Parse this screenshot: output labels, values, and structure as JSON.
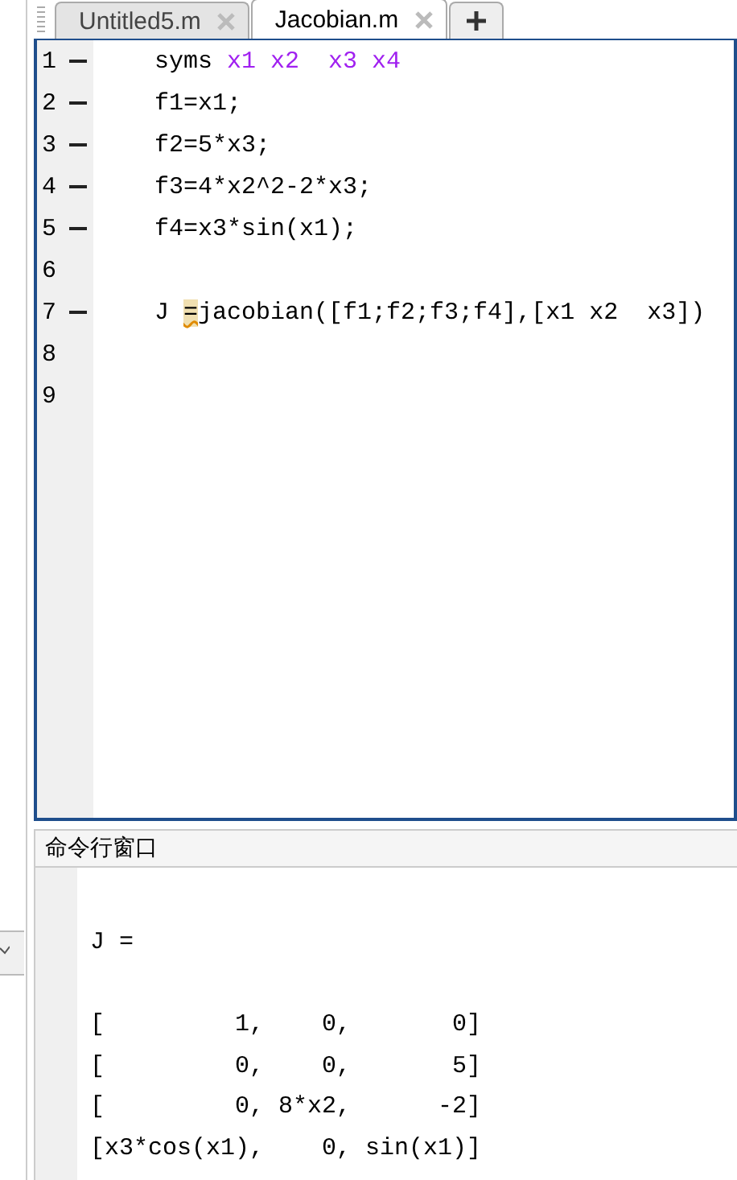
{
  "editor": {
    "tabs": [
      {
        "label": "Untitled5.m",
        "selected": false
      },
      {
        "label": "Jacobian.m",
        "selected": true
      }
    ],
    "lines": [
      {
        "number": "1",
        "executable": true,
        "segments": [
          {
            "kind": "plain",
            "text": "syms "
          },
          {
            "kind": "symbol",
            "text": "x1 x2  x3 x4"
          }
        ]
      },
      {
        "number": "2",
        "executable": true,
        "segments": [
          {
            "kind": "plain",
            "text": "f1=x1;"
          }
        ]
      },
      {
        "number": "3",
        "executable": true,
        "segments": [
          {
            "kind": "plain",
            "text": "f2=5*x3;"
          }
        ]
      },
      {
        "number": "4",
        "executable": true,
        "segments": [
          {
            "kind": "plain",
            "text": "f3=4*x2^2-2*x3;"
          }
        ]
      },
      {
        "number": "5",
        "executable": true,
        "segments": [
          {
            "kind": "plain",
            "text": "f4=x3*sin(x1);"
          }
        ]
      },
      {
        "number": "6",
        "executable": false
      },
      {
        "number": "7",
        "executable": true,
        "segments": [
          {
            "kind": "plain",
            "text": "J "
          },
          {
            "kind": "warning",
            "text": "="
          },
          {
            "kind": "plain",
            "text": "jacobian([f1;f2;f3;f4],[x1 x2  x3])"
          }
        ]
      },
      {
        "number": "8",
        "executable": false
      },
      {
        "number": "9",
        "executable": false
      }
    ]
  },
  "command_window": {
    "title": "命令行窗口",
    "output": [
      "J =",
      "[         1,    0,       0]",
      "[         0,    0,       5]",
      "[         0, 8*x2,      -2]",
      "[x3*cos(x1),    0, sin(x1)]"
    ]
  }
}
